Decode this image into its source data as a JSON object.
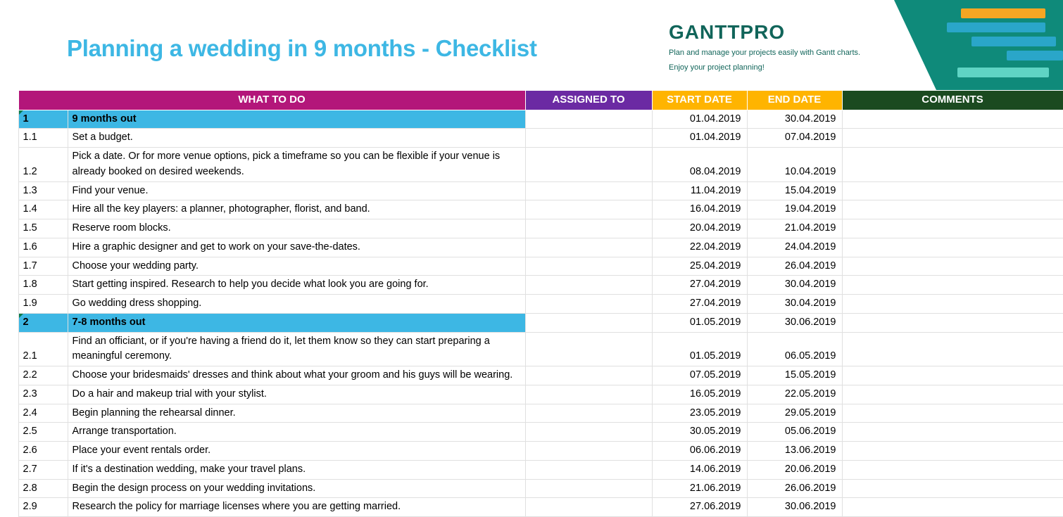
{
  "title": "Planning a wedding in 9 months - Checklist",
  "logo": {
    "name": "GANTTPRO",
    "desc1": "Plan and manage your projects easily with Gantt charts.",
    "desc2": "Enjoy your project planning!"
  },
  "headers": {
    "what": "WHAT TO DO",
    "assigned": "ASSIGNED TO",
    "start": "START DATE",
    "end": "END DATE",
    "comments": "COMMENTS"
  },
  "rows": [
    {
      "num": "1",
      "what": "9 months out",
      "assigned": "",
      "start": "01.04.2019",
      "end": "30.04.2019",
      "comments": "",
      "section": true
    },
    {
      "num": "1.1",
      "what": "Set a budget.",
      "assigned": "",
      "start": "01.04.2019",
      "end": "07.04.2019",
      "comments": ""
    },
    {
      "num": "1.2",
      "what": "Pick a date. Or for more venue options, pick a timeframe so you can be flexible if your venue is already booked on desired weekends.",
      "assigned": "",
      "start": "08.04.2019",
      "end": "10.04.2019",
      "comments": ""
    },
    {
      "num": "1.3",
      "what": "Find your venue.",
      "assigned": "",
      "start": "11.04.2019",
      "end": "15.04.2019",
      "comments": ""
    },
    {
      "num": "1.4",
      "what": "Hire all the key players: a planner, photographer, florist, and band.",
      "assigned": "",
      "start": "16.04.2019",
      "end": "19.04.2019",
      "comments": ""
    },
    {
      "num": "1.5",
      "what": "Reserve room blocks.",
      "assigned": "",
      "start": "20.04.2019",
      "end": "21.04.2019",
      "comments": ""
    },
    {
      "num": "1.6",
      "what": "Hire a graphic designer and get to work on your save-the-dates.",
      "assigned": "",
      "start": "22.04.2019",
      "end": "24.04.2019",
      "comments": ""
    },
    {
      "num": "1.7",
      "what": "Choose your wedding party.",
      "assigned": "",
      "start": "25.04.2019",
      "end": "26.04.2019",
      "comments": ""
    },
    {
      "num": "1.8",
      "what": "Start getting inspired. Research to help you decide what look you are going for.",
      "assigned": "",
      "start": "27.04.2019",
      "end": "30.04.2019",
      "comments": ""
    },
    {
      "num": "1.9",
      "what": "Go wedding dress shopping.",
      "assigned": "",
      "start": "27.04.2019",
      "end": "30.04.2019",
      "comments": ""
    },
    {
      "num": "2",
      "what": "7-8 months out",
      "assigned": "",
      "start": "01.05.2019",
      "end": "30.06.2019",
      "comments": "",
      "section": true
    },
    {
      "num": "2.1",
      "what": "Find an officiant, or if you're having a friend do it, let them know so they can start preparing a meaningful ceremony.",
      "assigned": "",
      "start": "01.05.2019",
      "end": "06.05.2019",
      "comments": ""
    },
    {
      "num": "2.2",
      "what": "Choose your bridesmaids' dresses and think about what your groom and his guys will be wearing.",
      "assigned": "",
      "start": "07.05.2019",
      "end": "15.05.2019",
      "comments": ""
    },
    {
      "num": "2.3",
      "what": "Do a hair and makeup trial with your stylist.",
      "assigned": "",
      "start": "16.05.2019",
      "end": "22.05.2019",
      "comments": ""
    },
    {
      "num": "2.4",
      "what": "Begin planning the rehearsal dinner.",
      "assigned": "",
      "start": "23.05.2019",
      "end": "29.05.2019",
      "comments": ""
    },
    {
      "num": "2.5",
      "what": "Arrange transportation.",
      "assigned": "",
      "start": "30.05.2019",
      "end": "05.06.2019",
      "comments": ""
    },
    {
      "num": "2.6",
      "what": "Place your event rentals order.",
      "assigned": "",
      "start": "06.06.2019",
      "end": "13.06.2019",
      "comments": ""
    },
    {
      "num": "2.7",
      "what": "If it's a destination wedding, make your travel plans.",
      "assigned": "",
      "start": "14.06.2019",
      "end": "20.06.2019",
      "comments": ""
    },
    {
      "num": "2.8",
      "what": "Begin the design process on your wedding invitations.",
      "assigned": "",
      "start": "21.06.2019",
      "end": "26.06.2019",
      "comments": ""
    },
    {
      "num": "2.9",
      "what": "Research the policy for marriage licenses where you are getting married.",
      "assigned": "",
      "start": "27.06.2019",
      "end": "30.06.2019",
      "comments": ""
    }
  ]
}
